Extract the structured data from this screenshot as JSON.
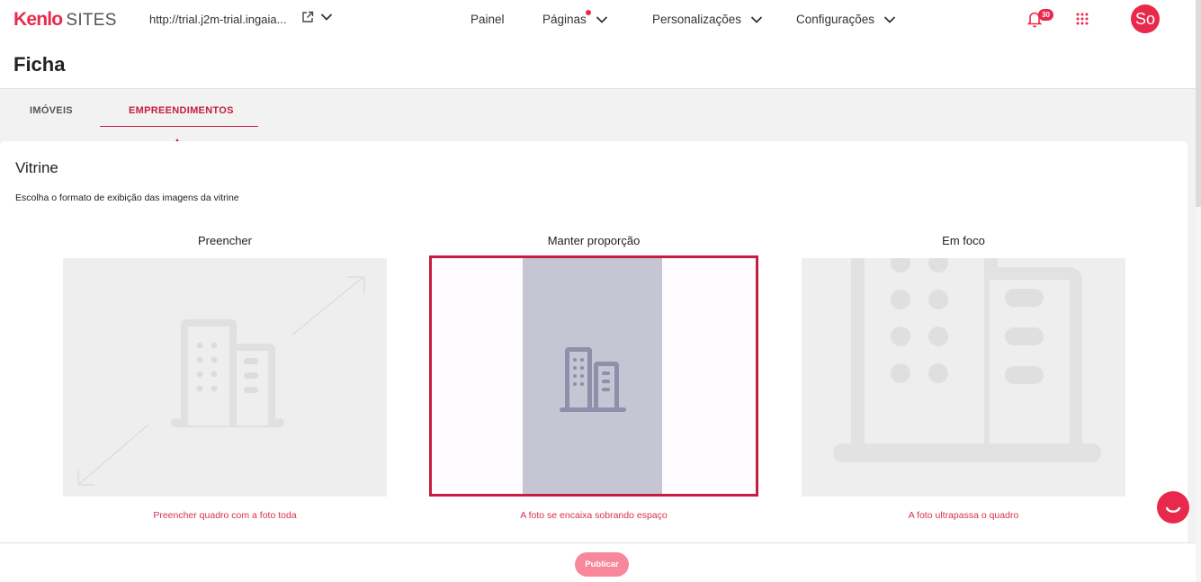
{
  "topbar": {
    "brand": "Kenlo",
    "brand_suffix": "SITES",
    "site_url": "http://trial.j2m-trial.ingaia...",
    "nav": {
      "painel": "Painel",
      "paginas": "Páginas",
      "personalizacoes": "Personalizações",
      "configuracoes": "Configurações"
    },
    "notification_count": "30",
    "avatar_initials": "So"
  },
  "header": {
    "title": "Ficha"
  },
  "tabs": {
    "imoveis": "IMÓVEIS",
    "empreendimentos": "EMPREENDIMENTOS"
  },
  "vitrine": {
    "title": "Vitrine",
    "description": "Escolha o formato de exibição das imagens da vitrine",
    "options": [
      {
        "label": "Preencher",
        "caption": "Preencher quadro com a foto toda"
      },
      {
        "label": "Manter proporção",
        "caption": "A foto se encaixa sobrando espaço"
      },
      {
        "label": "Em foco",
        "caption": "A foto ultrapassa o quadro"
      }
    ]
  },
  "footer": {
    "publish_label": "Publicar"
  },
  "colors": {
    "accent": "#e8294c",
    "selected_border": "#c41e40",
    "band": "#c5c5d4"
  }
}
